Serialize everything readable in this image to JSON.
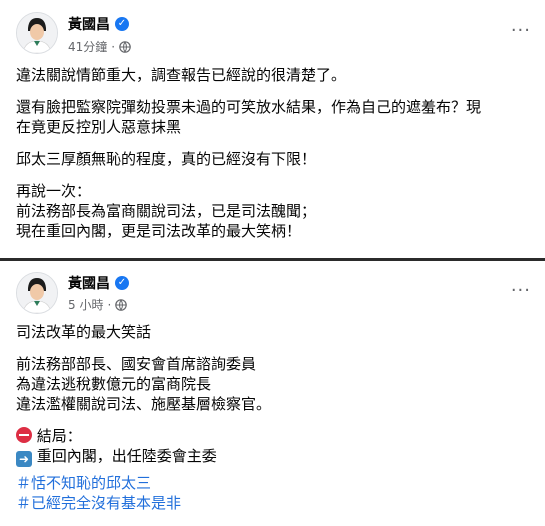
{
  "posts": [
    {
      "author": "黃國昌",
      "time": "41分鐘",
      "paragraphs": [
        [
          "違法關說情節重大，調查報告已經說的很清楚了。"
        ],
        [
          "還有臉把監察院彈劾投票未過的可笑放水結果，作為自己的遮羞布？現",
          "在竟更反控別人惡意抹黑"
        ],
        [
          "邱太三厚顏無恥的程度，真的已經沒有下限！"
        ],
        [
          "再說一次：",
          "前法務部長為富商關說司法，已是司法醜聞；",
          "現在重回內閣，更是司法改革的最大笑柄！"
        ]
      ]
    },
    {
      "author": "黃國昌",
      "time": "5 小時",
      "paragraphs": [
        [
          "司法改革的最大笑話"
        ],
        [
          "前法務部部長、國安會首席諮詢委員",
          "為違法逃稅數億元的富商院長",
          "違法濫權關說司法、施壓基層檢察官。"
        ]
      ],
      "outcome_title": "結局：",
      "outcome_line": "重回內閣，出任陸委會主委",
      "hashtags": [
        "＃恬不知恥的邱太三",
        "＃已經完全沒有基本是非"
      ]
    }
  ],
  "icons": {
    "verified": "verified-badge-icon",
    "audience": "globe-icon",
    "more": "more-options-icon",
    "stop": "no-entry-icon",
    "arrow": "right-arrow-icon"
  },
  "colors": {
    "link": "#216fdb",
    "verified": "#1877f2",
    "meta_text": "#65676b"
  }
}
